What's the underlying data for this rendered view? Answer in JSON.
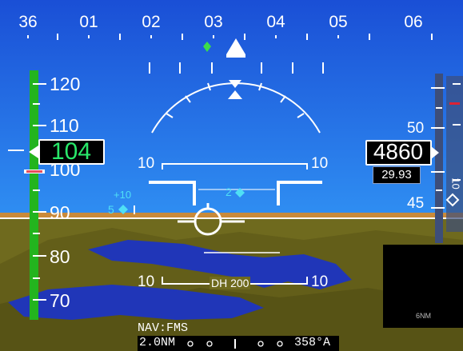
{
  "colors": {
    "sky_top": "#1a4fd6",
    "sky_bottom": "#2f8ef2",
    "terrain": "#6f6a1e",
    "water": "#2036b8",
    "horizon": "#c98a3a",
    "speed_tape": "#23b41e",
    "airspeed_digits": "#29e86a",
    "waypoint_cyan": "#4fe0f5",
    "flight_director": "#ffffff"
  },
  "heading_scale": {
    "labels": [
      "36",
      "01",
      "02",
      "03",
      "04",
      "05",
      "06"
    ]
  },
  "airspeed": {
    "current": "104",
    "tape_labels": [
      "120",
      "110",
      "100",
      "90",
      "80",
      "70"
    ]
  },
  "altitude": {
    "current": "4860",
    "baro_setting": "29.93",
    "tape_labels": [
      "50",
      "45"
    ],
    "vsi_label": "10"
  },
  "pitch_ladder": {
    "upper_left": "10",
    "upper_right": "10",
    "lower_left": "10",
    "lower_right": "10",
    "decision_height": "DH 200"
  },
  "traffic": [
    {
      "label": "+10",
      "distance": "5"
    },
    {
      "label": "2",
      "distance": "2"
    }
  ],
  "navigation": {
    "source": "NAV:FMS",
    "distance": "2.0NM",
    "course": "358°A"
  },
  "inset_map": {
    "range": "6NM"
  }
}
